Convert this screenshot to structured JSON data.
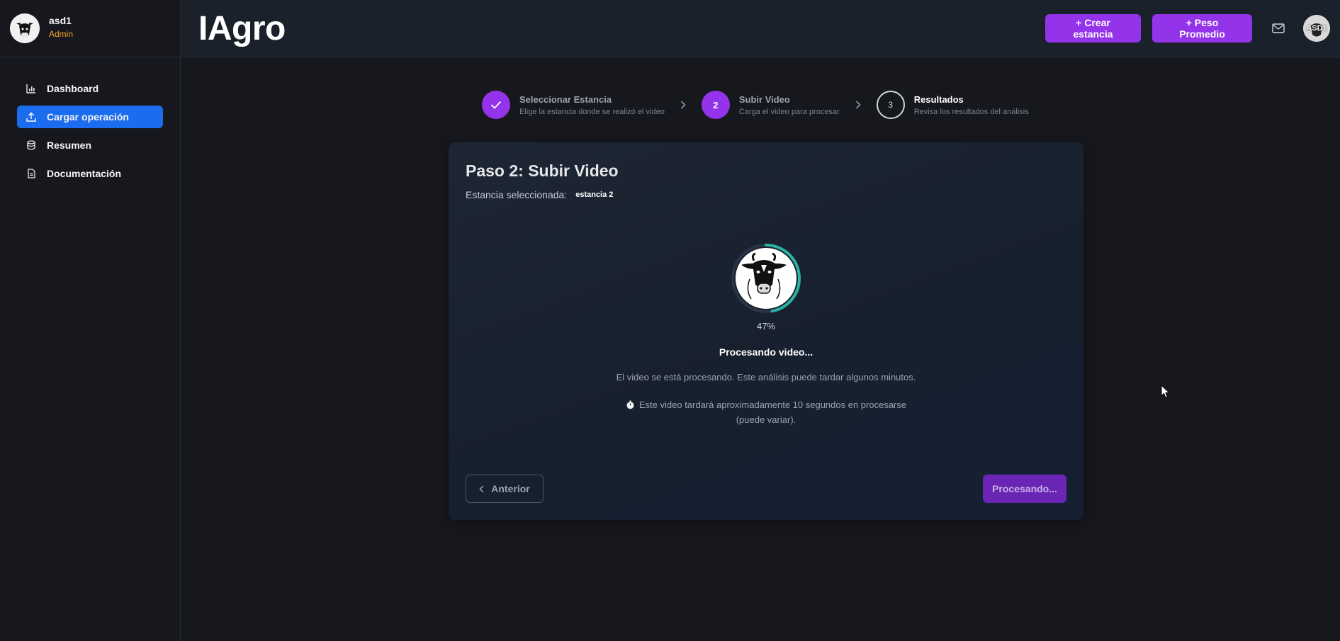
{
  "user": {
    "name": "asd1",
    "role": "Admin"
  },
  "sidebar": {
    "items": [
      {
        "label": "Dashboard",
        "icon": "bar-chart-icon"
      },
      {
        "label": "Cargar operación",
        "icon": "upload-icon"
      },
      {
        "label": "Resumen",
        "icon": "database-icon"
      },
      {
        "label": "Documentación",
        "icon": "document-icon"
      }
    ]
  },
  "header": {
    "brand": "IAgro",
    "crear_estancia": "+ Crear estancia",
    "peso_promedio": "+ Peso Promedio",
    "avatar_initials": "ASD1"
  },
  "stepper": {
    "steps": [
      {
        "title": "Seleccionar Estancia",
        "subtitle": "Elige la estancia donde se realizó el video",
        "state": "done"
      },
      {
        "number": "2",
        "title": "Subir Video",
        "subtitle": "Carga el video para procesar",
        "state": "current"
      },
      {
        "number": "3",
        "title": "Resultados",
        "subtitle": "Revisa los resultados del análisis",
        "state": "pending"
      }
    ]
  },
  "card": {
    "title": "Paso 2: Subir Video",
    "estancia_label": "Estancia seleccionada:",
    "estancia_value": "estancia 2",
    "progress_percent": 47,
    "progress_label": "47%",
    "processing_title": "Procesando video...",
    "processing_desc": "El video se está procesando. Este análisis puede tardar algunos minutos.",
    "eta_line1": "Este video tardará aproximadamente 10 segundos en procesarse",
    "eta_line2": "(puede variar).",
    "btn_previous": "Anterior",
    "btn_processing": "Procesando..."
  },
  "colors": {
    "accent_purple": "#9333ea",
    "active_blue": "#1c6cf0",
    "progress_teal": "#2bb3a3",
    "role_orange": "#f0a02b"
  }
}
